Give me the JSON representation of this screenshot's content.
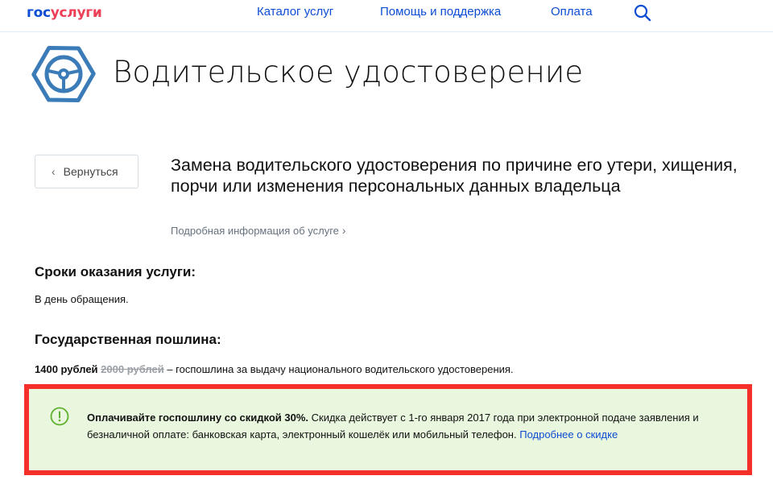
{
  "header": {
    "logo_gos": "гос",
    "logo_uslugi": "услуги",
    "nav": [
      "Каталог услуг",
      "Помощь и поддержка",
      "Оплата"
    ]
  },
  "page": {
    "title": "Водительское удостоверение",
    "icon": "steering-wheel-icon"
  },
  "back_button": {
    "label": "Вернуться"
  },
  "service": {
    "title": "Замена водительского удостоверения по причине его утери, хищения, порчи или изменения персональных данных владельца",
    "info_link": "Подробная информация об услуге"
  },
  "terms": {
    "heading": "Сроки оказания услуги:",
    "text": "В день обращения."
  },
  "fee": {
    "heading": "Государственная пошлина:",
    "price": "1400 рублей",
    "old_price": "2000 рублей",
    "description": " – госпошлина за выдачу национального водительского удостоверения."
  },
  "notice": {
    "bold": "Оплачивайте госпошлину со скидкой 30%.",
    "text": " Скидка действует с 1-го января 2017 года при электронной подаче заявления и безналичной оплате: банковская карта, электронный кошелёк или мобильный телефон. ",
    "link": "Подробнее о скидке"
  },
  "colors": {
    "brand_blue": "#0d4cd3",
    "brand_red": "#ee3f58",
    "notice_bg": "#eaf7df",
    "highlight_frame": "#f5302b",
    "icon_blue": "#3a7bb8"
  }
}
